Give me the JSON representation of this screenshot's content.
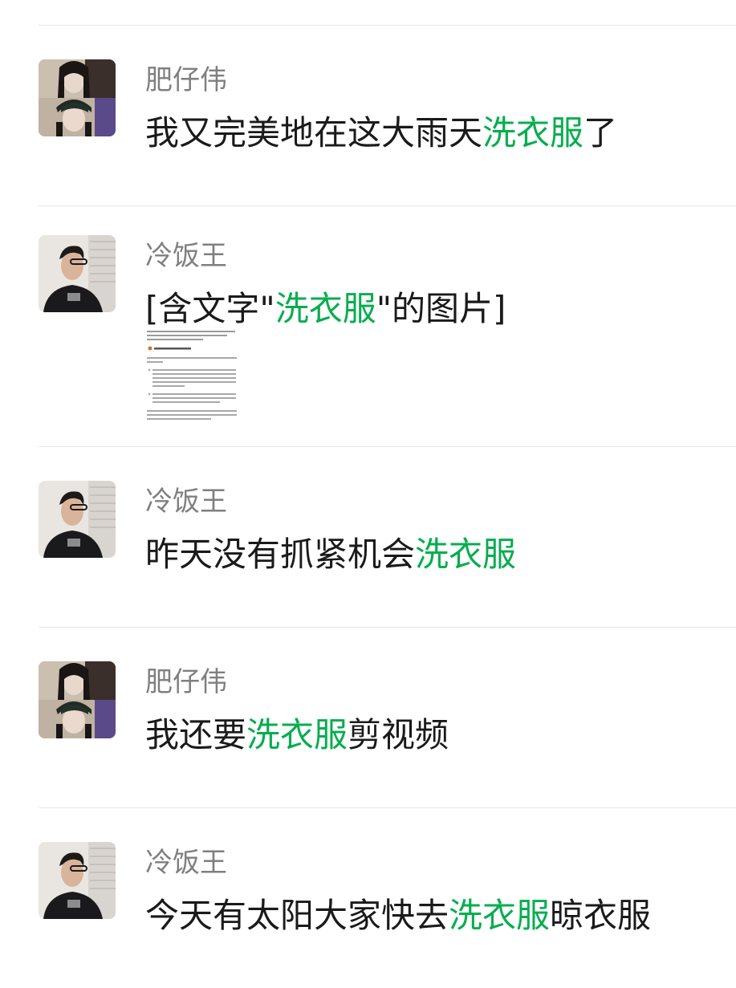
{
  "colors": {
    "highlight": "#07ad4f",
    "text": "#1a1a1a",
    "sender": "#7f7f7f",
    "divider": "#e7e7e7"
  },
  "messages": [
    {
      "sender": "肥仔伟",
      "avatar": "girl-photo-avatar",
      "text_before": "我又完美地在这大雨天",
      "highlight": "洗衣服",
      "text_after": "了"
    },
    {
      "sender": "冷饭王",
      "avatar": "man-photo-avatar",
      "text_before": "[含文字\"",
      "highlight": "洗衣服",
      "text_after": "\"的图片]",
      "thumbnail": "document-image-thumbnail"
    },
    {
      "sender": "冷饭王",
      "avatar": "man-photo-avatar",
      "text_before": "昨天没有抓紧机会",
      "highlight": "洗衣服",
      "text_after": ""
    },
    {
      "sender": "肥仔伟",
      "avatar": "girl-photo-avatar",
      "text_before": "我还要",
      "highlight": "洗衣服",
      "text_after": "剪视频"
    },
    {
      "sender": "冷饭王",
      "avatar": "man-photo-avatar",
      "text_before": "今天有太阳大家快去",
      "highlight": "洗衣服",
      "text_after": "晾衣服"
    }
  ]
}
